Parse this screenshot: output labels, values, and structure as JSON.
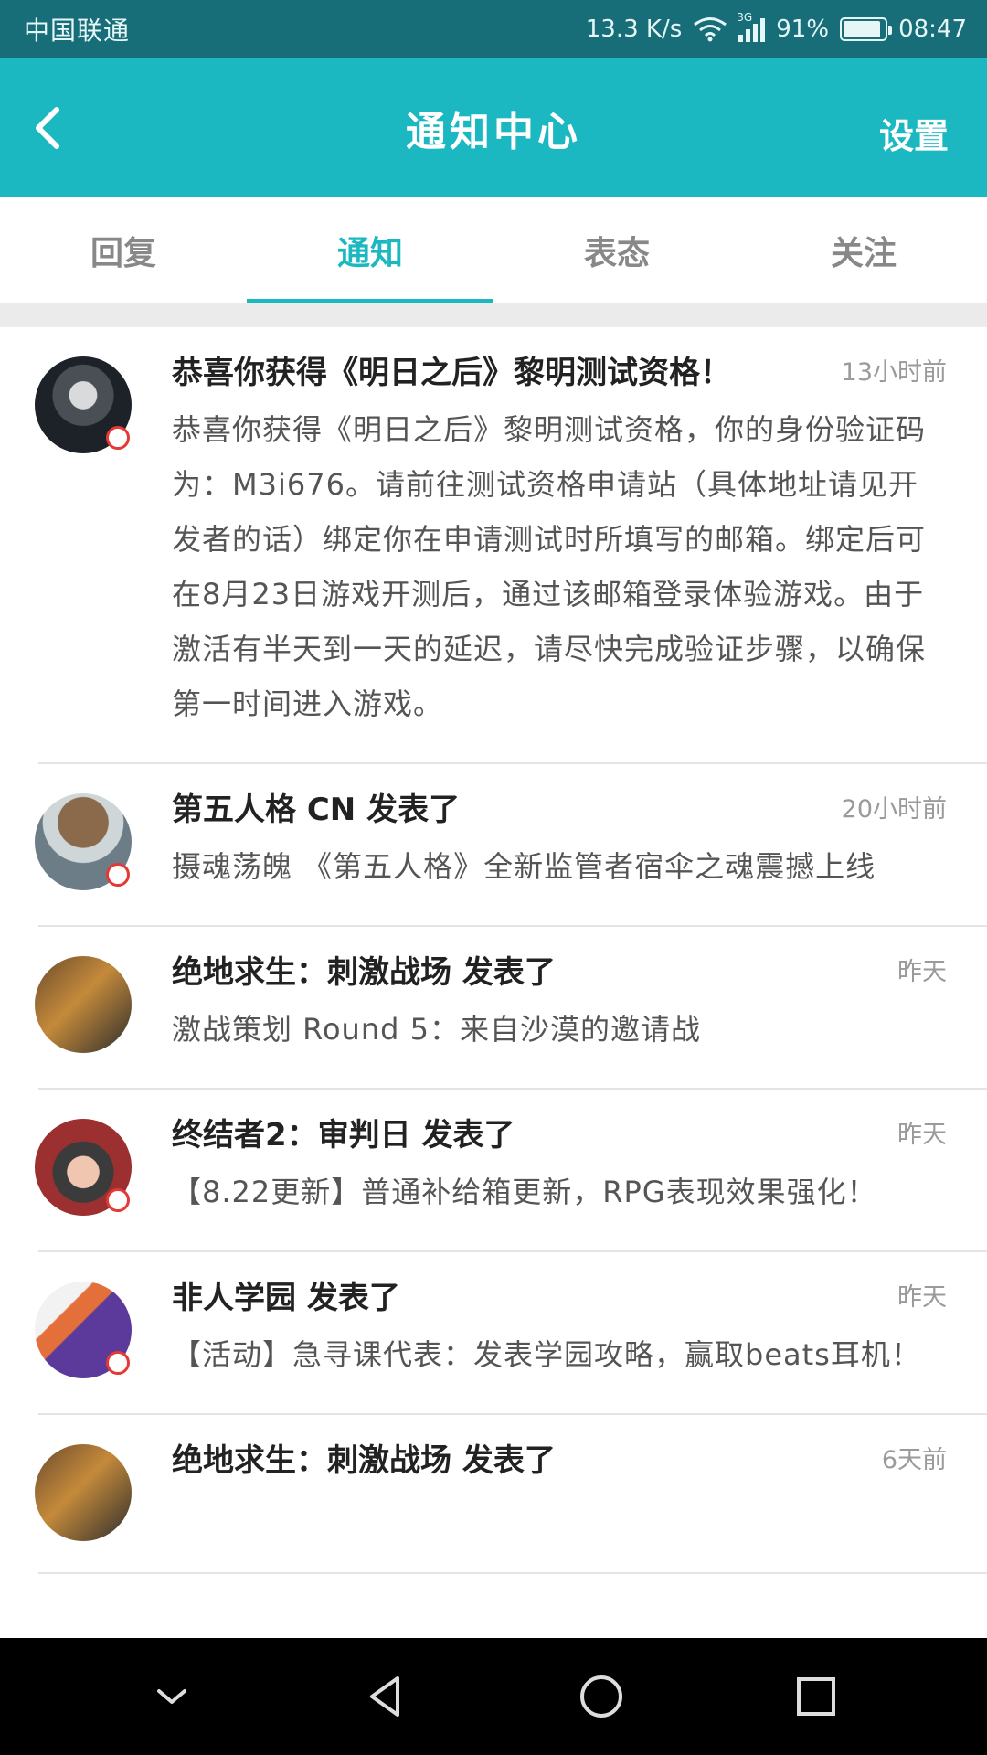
{
  "status_bar": {
    "carrier": "中国联通",
    "speed": "13.3 K/s",
    "network": "3G",
    "battery": "91%",
    "battery_level": 0.91,
    "time": "08:47"
  },
  "header": {
    "title": "通知中心",
    "settings_label": "设置",
    "back_icon": "chevron-left-icon"
  },
  "tabs": [
    {
      "label": "回复",
      "active": false
    },
    {
      "label": "通知",
      "active": true
    },
    {
      "label": "表态",
      "active": false
    },
    {
      "label": "关注",
      "active": false
    }
  ],
  "notifications": [
    {
      "title": "恭喜你获得《明日之后》黎明测试资格！",
      "time": "13小时前",
      "body": "恭喜你获得《明日之后》黎明测试资格，你的身份验证码为：M3i676。请前往测试资格申请站（具体地址请见开发者的话）绑定你在申请测试时所填写的邮箱。绑定后可在8月23日游戏开测后，通过该邮箱登录体验游戏。由于激活有半天到一天的延迟，请尽快完成验证步骤，以确保第一时间进入游戏。"
    },
    {
      "title": "第五人格 CN 发表了",
      "time": "20小时前",
      "body": "摄魂荡魄 《第五人格》全新监管者宿伞之魂震撼上线"
    },
    {
      "title": "绝地求生：刺激战场 发表了",
      "time": "昨天",
      "body": "激战策划 Round 5：来自沙漠的邀请战"
    },
    {
      "title": "终结者2：审判日 发表了",
      "time": "昨天",
      "body": "【8.22更新】普通补给箱更新，RPG表现效果强化！"
    },
    {
      "title": "非人学园 发表了",
      "time": "昨天",
      "body": "【活动】急寻课代表：发表学园攻略，赢取beats耳机！"
    },
    {
      "title": "绝地求生：刺激战场 发表了",
      "time": "6天前",
      "body": ""
    }
  ],
  "navbar": {
    "items": [
      "chevron-down-icon",
      "back-triangle-icon",
      "home-circle-icon",
      "recent-square-icon"
    ]
  }
}
